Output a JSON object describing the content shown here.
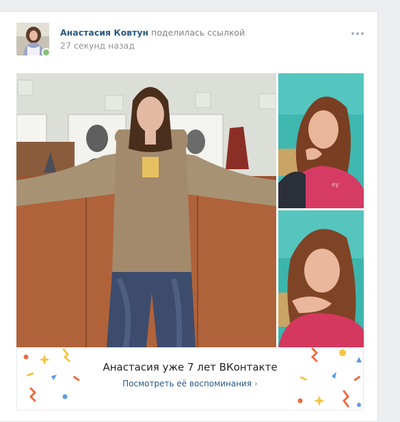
{
  "post": {
    "author_name": "Анастасия Ковтун",
    "action": "поделилась ссылкой",
    "time": "27 секунд назад"
  },
  "memory": {
    "title": "Анастасия уже 7 лет ВКонтакте",
    "link_label": "Посмотреть её воспоминания"
  },
  "colors": {
    "link": "#2a5885",
    "online": "#8ac176",
    "confetti_orange": "#f0693c",
    "confetti_yellow": "#f5c543",
    "confetti_blue": "#5b9ae6"
  },
  "icons": {
    "more": "more-horizontal-icon",
    "chevron": "chevron-right-icon",
    "online": "online-indicator-icon"
  }
}
